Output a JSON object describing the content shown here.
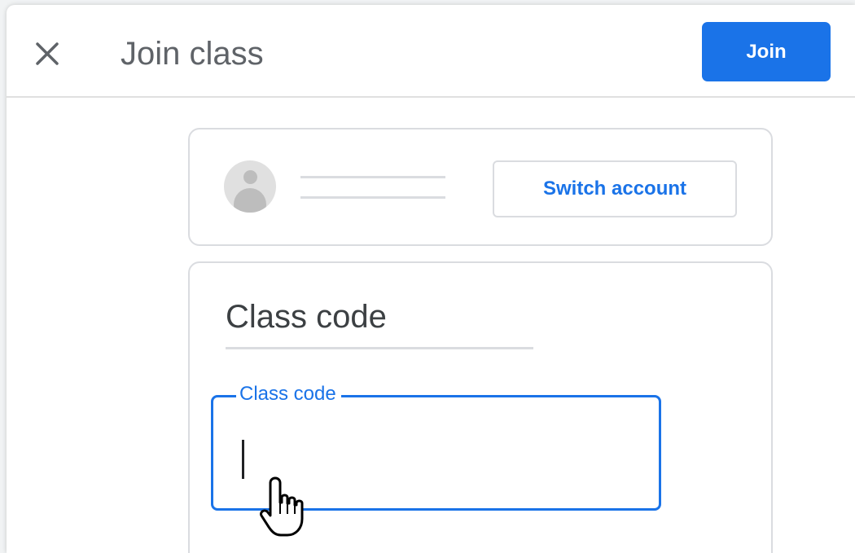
{
  "header": {
    "title": "Join class",
    "join_label": "Join"
  },
  "account": {
    "switch_label": "Switch account"
  },
  "class_code": {
    "section_title": "Class code",
    "field_label": "Class code",
    "value": ""
  },
  "colors": {
    "accent": "#1a73e8",
    "title_text": "#5f6368",
    "border": "#dadce0"
  },
  "icons": {
    "close": "close-icon",
    "avatar": "account-avatar-icon",
    "pointer": "hand-pointer-cursor-icon"
  }
}
